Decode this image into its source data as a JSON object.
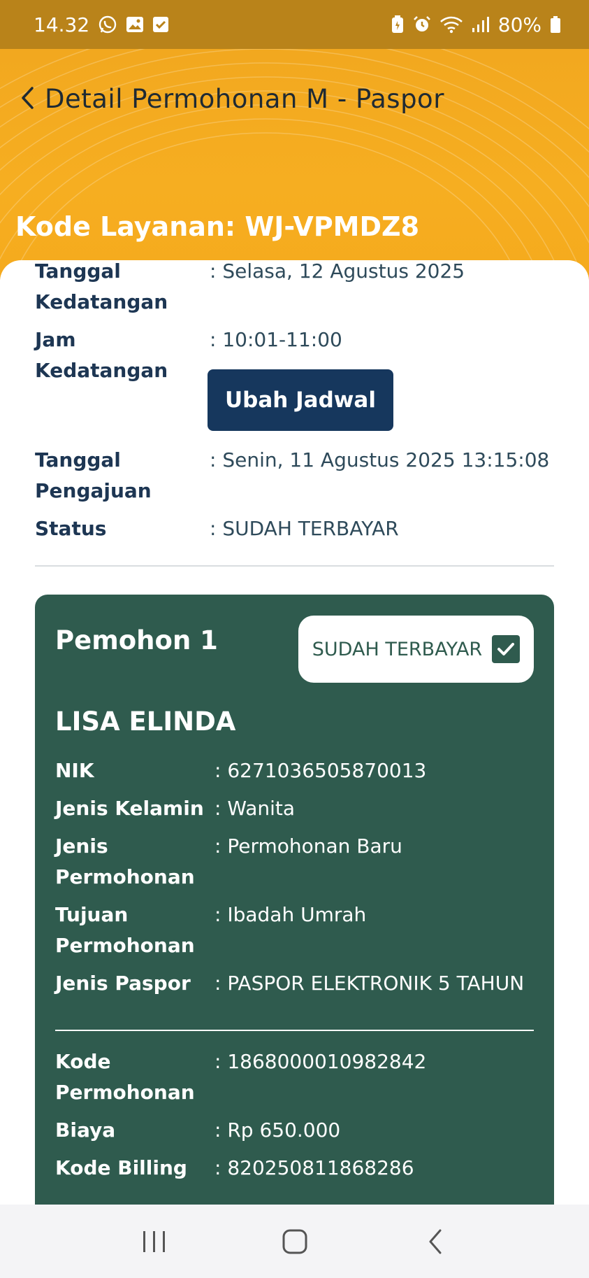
{
  "status_bar": {
    "time": "14.32",
    "battery": "80%"
  },
  "header": {
    "title": "Detail Permohonan M - Paspor",
    "kode_layanan": "Kode Layanan: WJ-VPMDZ8"
  },
  "details": {
    "tanggal_kedatangan_label_1": "Tanggal",
    "tanggal_kedatangan_label_2": "Kedatangan",
    "tanggal_kedatangan_value": ": Selasa, 12 Agustus 2025",
    "jam_kedatangan_label": "Jam Kedatangan",
    "jam_kedatangan_value": ": 10:01-11:00",
    "ubah_jadwal_button": "Ubah Jadwal",
    "tanggal_pengajuan_label_1": "Tanggal",
    "tanggal_pengajuan_label_2": "Pengajuan",
    "tanggal_pengajuan_value": ": Senin, 11 Agustus 2025 13:15:08",
    "status_label": "Status",
    "status_value": ": SUDAH TERBAYAR"
  },
  "applicant": {
    "heading": "Pemohon 1",
    "badge": "SUDAH TERBAYAR",
    "name": "LISA ELINDA",
    "nik_label": "NIK",
    "nik_value": ": 6271036505870013",
    "jenis_kelamin_label": "Jenis Kelamin",
    "jenis_kelamin_value": ": Wanita",
    "jenis_permohonan_label_1": "Jenis",
    "jenis_permohonan_label_2": "Permohonan",
    "jenis_permohonan_value": ": Permohonan Baru",
    "tujuan_permohonan_label_1": "Tujuan",
    "tujuan_permohonan_label_2": "Permohonan",
    "tujuan_permohonan_value": ": Ibadah Umrah",
    "jenis_paspor_label": "Jenis Paspor",
    "jenis_paspor_value": ": PASPOR ELEKTRONIK 5 TAHUN",
    "kode_permohonan_label_1": "Kode",
    "kode_permohonan_label_2": "Permohonan",
    "kode_permohonan_value": ": 1868000010982842",
    "biaya_label": "Biaya",
    "biaya_value": ": Rp 650.000",
    "kode_billing_label": "Kode Billing",
    "kode_billing_value": ": 820250811868286"
  },
  "icons": {
    "status_left": [
      "whatsapp-icon",
      "gallery-icon",
      "checkbox-icon"
    ],
    "status_right": [
      "battery-saver-icon",
      "alarm-icon",
      "wifi-icon",
      "signal-icon",
      "battery-icon"
    ],
    "nav": [
      "recent-apps-icon",
      "home-icon",
      "back-icon"
    ]
  },
  "colors": {
    "header_yellow": "#f5aa1d",
    "status_bar": "#b9831a",
    "button_navy": "#16375d",
    "card_green": "#2f5b4e"
  }
}
